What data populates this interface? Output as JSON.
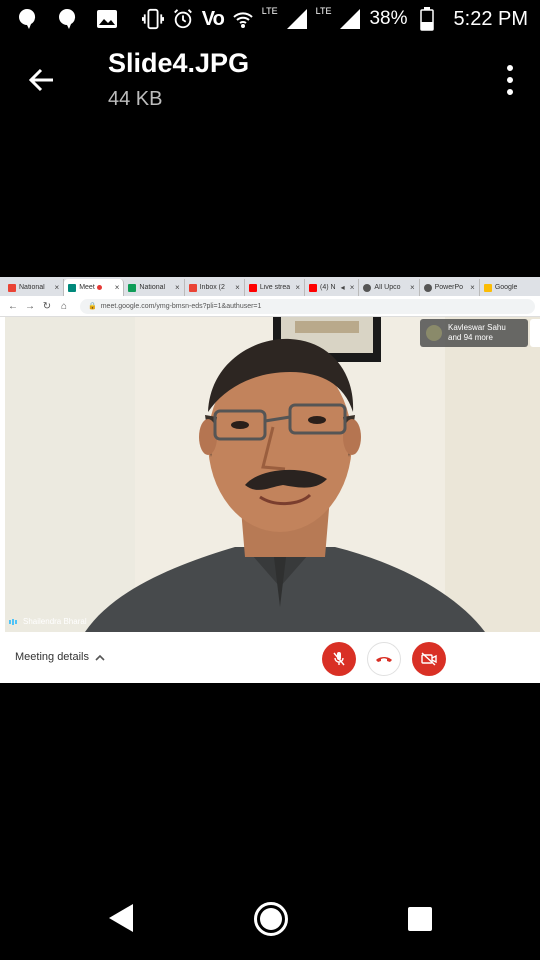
{
  "status_bar": {
    "volte": "Vo",
    "lte_small": "LTE",
    "lte": "LTE",
    "battery": "38%",
    "time": "5:22 PM"
  },
  "app_bar": {
    "file_name": "Slide4.JPG",
    "file_size": "44 KB"
  },
  "browser": {
    "tabs": [
      {
        "title": "National",
        "favicon_color": "#ea4335"
      },
      {
        "title": "Meet",
        "favicon_color": "#00897b"
      },
      {
        "title": "National",
        "favicon_color": "#0f9d58"
      },
      {
        "title": "Inbox (2",
        "favicon_color": "#ea4335"
      },
      {
        "title": "Live strea",
        "favicon_color": "#ff0000"
      },
      {
        "title": "(4) N",
        "favicon_color": "#ff0000"
      },
      {
        "title": "All Upco",
        "favicon_color": "#555555"
      },
      {
        "title": "PowerPo",
        "favicon_color": "#555555"
      },
      {
        "title": "Google",
        "favicon_color": "#fbbc05"
      }
    ],
    "url": "meet.google.com/ymg-bmsn-eds?pli=1&authuser=1"
  },
  "meet": {
    "participants_line1": "Kavleswar Sahu",
    "participants_line2": "and 94 more",
    "speaker_name": "Shailendra Bharal",
    "meeting_details": "Meeting details"
  },
  "colors": {
    "accent_red": "#d93025",
    "background": "#000000"
  }
}
